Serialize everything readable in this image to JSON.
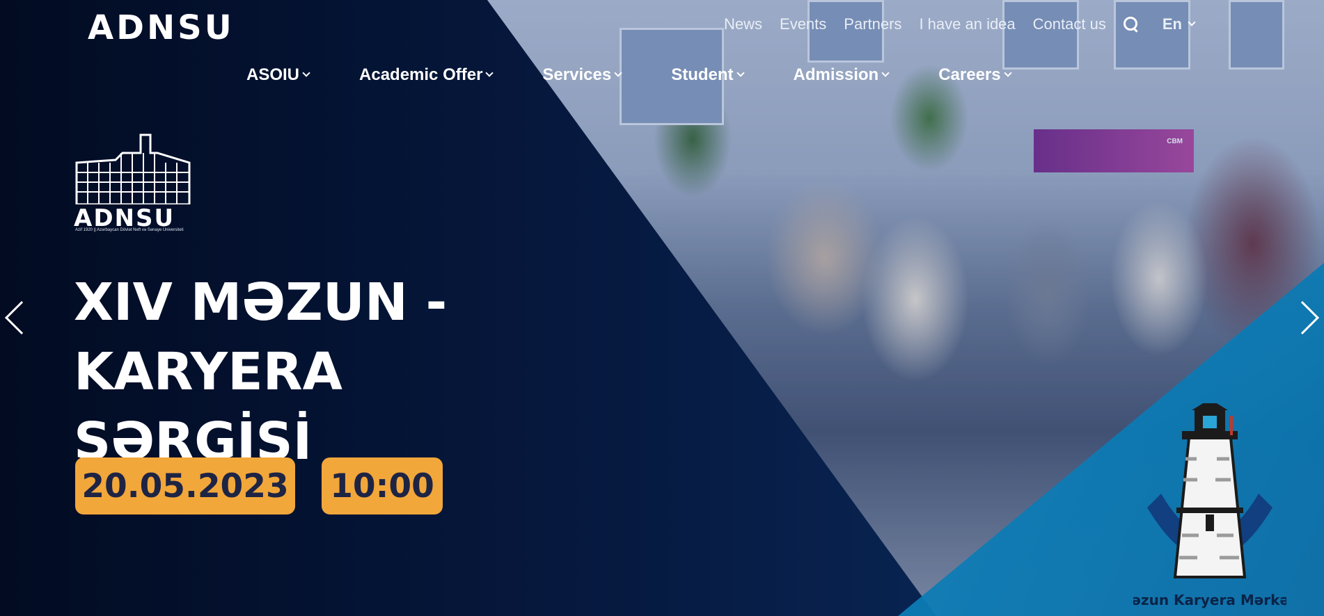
{
  "header": {
    "logo_text": "ADNSU",
    "top_links": [
      "News",
      "Events",
      "Partners",
      "I have an idea",
      "Contact us"
    ],
    "language": "En"
  },
  "main_nav": [
    {
      "label": "ASOIU"
    },
    {
      "label": "Academic Offer"
    },
    {
      "label": "Services"
    },
    {
      "label": "Student"
    },
    {
      "label": "Admission"
    },
    {
      "label": "Careers"
    }
  ],
  "slide": {
    "logo_wordmark": "ADNSU",
    "logo_caption": "Azif 1920 || Azərbaycan Dövlət Neft və Sənaye Universiteti",
    "title_line1": "XIV MƏZUN - KARYERA",
    "title_line2": "SƏRGİSİ",
    "date": "20.05.2023",
    "time": "10:00",
    "banner_text": "CBM",
    "emblem_text": "Məzun Karyera Mərkəzi"
  },
  "colors": {
    "accent": "#f2a73b",
    "dark_navy": "#061a3a",
    "cyan": "#1aa1cf"
  }
}
